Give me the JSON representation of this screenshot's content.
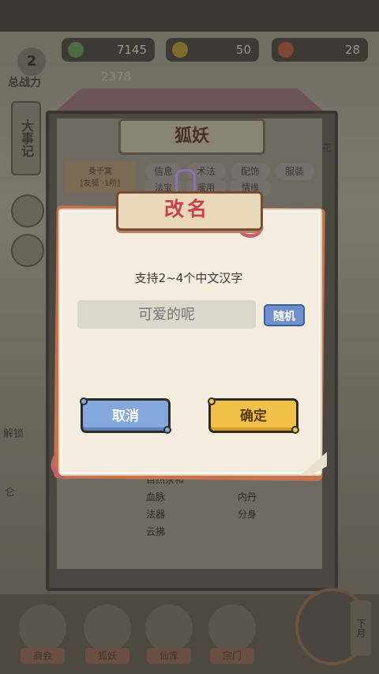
{
  "resources": [
    {
      "icon": "jade-icon",
      "value": "7145",
      "color": "#6ba35a"
    },
    {
      "icon": "gold-ingot-icon",
      "value": "50",
      "color": "#d5b43a"
    },
    {
      "icon": "spirit-fruit-icon",
      "value": "28",
      "color": "#d46a4a"
    }
  ],
  "player": {
    "level": "2",
    "power_label": "总战力",
    "power_value": "2378"
  },
  "screen": {
    "title": "狐妖",
    "side_tab": "大事记",
    "tabs_row1": [
      "信息",
      "术法",
      "配饰",
      "服装"
    ],
    "tabs_row2": [
      "法宝",
      "暖用",
      "情缘"
    ],
    "identity_line1": "桑千寞",
    "identity_line2": "[友狐 ·1阶]",
    "right_skill": "花",
    "left_caption1": "解锁",
    "left_caption2": "仑",
    "stats_header": "自然亲和",
    "stats": [
      [
        "血脉",
        "内丹"
      ],
      [
        "法器",
        "分身"
      ],
      [
        "云拂",
        ""
      ]
    ]
  },
  "bottom_nav": [
    "商会",
    "狐妖",
    "仙库",
    "宗门"
  ],
  "bottom_right_vertical": "下月",
  "dialog": {
    "title": "改名",
    "hint": "支持2~4个中文汉字",
    "name_placeholder": "可爱的呢",
    "random_label": "随机",
    "cancel_label": "取消",
    "confirm_label": "确定"
  },
  "colors": {
    "title_red": "#c6414d",
    "cancel_blue": "#84a7dd",
    "confirm_yellow": "#f1c149",
    "random_blue": "#6e90cf",
    "paper": "#f3ecdf"
  }
}
